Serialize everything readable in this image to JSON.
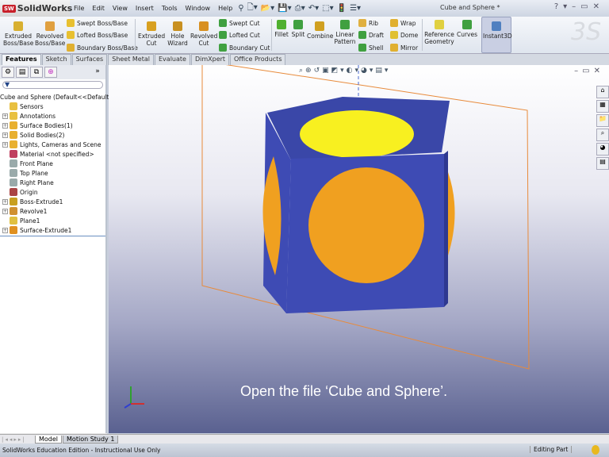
{
  "app": {
    "name": "SolidWorks",
    "badge": "SW",
    "document_title": "Cube and Sphere *"
  },
  "menu": [
    "File",
    "Edit",
    "View",
    "Insert",
    "Tools",
    "Window",
    "Help"
  ],
  "ribbon": {
    "extruded_boss": "Extruded Boss/Base",
    "revolved_boss": "Revolved Boss/Base",
    "swept_boss": "Swept Boss/Base",
    "lofted_boss": "Lofted Boss/Base",
    "boundary_boss": "Boundary Boss/Base",
    "extruded_cut": "Extruded Cut",
    "hole_wizard": "Hole Wizard",
    "revolved_cut": "Revolved Cut",
    "swept_cut": "Swept Cut",
    "lofted_cut": "Lofted Cut",
    "boundary_cut": "Boundary Cut",
    "fillet": "Fillet",
    "split": "Split",
    "combine": "Combine",
    "linear_pattern": "Linear Pattern",
    "rib": "Rib",
    "draft": "Draft",
    "shell": "Shell",
    "wrap": "Wrap",
    "dome": "Dome",
    "mirror": "Mirror",
    "reference_geometry": "Reference Geometry",
    "curves": "Curves",
    "instant3d": "Instant3D"
  },
  "tabs": [
    "Features",
    "Sketch",
    "Surfaces",
    "Sheet Metal",
    "Evaluate",
    "DimXpert",
    "Office Products"
  ],
  "tree": [
    {
      "label": "Cube and Sphere  (Default<<Default",
      "exp": false,
      "color": "#c8a020"
    },
    {
      "label": "Sensors",
      "exp": false,
      "color": "#e8c040"
    },
    {
      "label": "Annotations",
      "exp": true,
      "color": "#e8c040"
    },
    {
      "label": "Surface Bodies(1)",
      "exp": true,
      "color": "#e8b030"
    },
    {
      "label": "Solid Bodies(2)",
      "exp": true,
      "color": "#e8b030"
    },
    {
      "label": "Lights, Cameras and Scene",
      "exp": true,
      "color": "#e8b030"
    },
    {
      "label": "Material <not specified>",
      "exp": false,
      "color": "#c04060"
    },
    {
      "label": "Front Plane",
      "exp": false,
      "color": "#9aa"
    },
    {
      "label": "Top Plane",
      "exp": false,
      "color": "#9aa"
    },
    {
      "label": "Right Plane",
      "exp": false,
      "color": "#9aa"
    },
    {
      "label": "Origin",
      "exp": false,
      "color": "#a44"
    },
    {
      "label": "Boss-Extrude1",
      "exp": true,
      "color": "#c8a020"
    },
    {
      "label": "Revolve1",
      "exp": true,
      "color": "#d09030"
    },
    {
      "label": "Plane1",
      "exp": false,
      "color": "#e0c040"
    },
    {
      "label": "Surface-Extrude1",
      "exp": true,
      "color": "#e09020"
    }
  ],
  "caption": "Open the file ‘Cube and Sphere’.",
  "bottom_tabs": {
    "model": "Model",
    "motion": "Motion Study 1"
  },
  "status": {
    "text": "SolidWorks Education Edition - Instructional Use Only",
    "mode": "Editing Part"
  },
  "colors": {
    "cube": "#3e4bb4",
    "sphere": "#f0a020",
    "plane": "#e88a3a"
  }
}
